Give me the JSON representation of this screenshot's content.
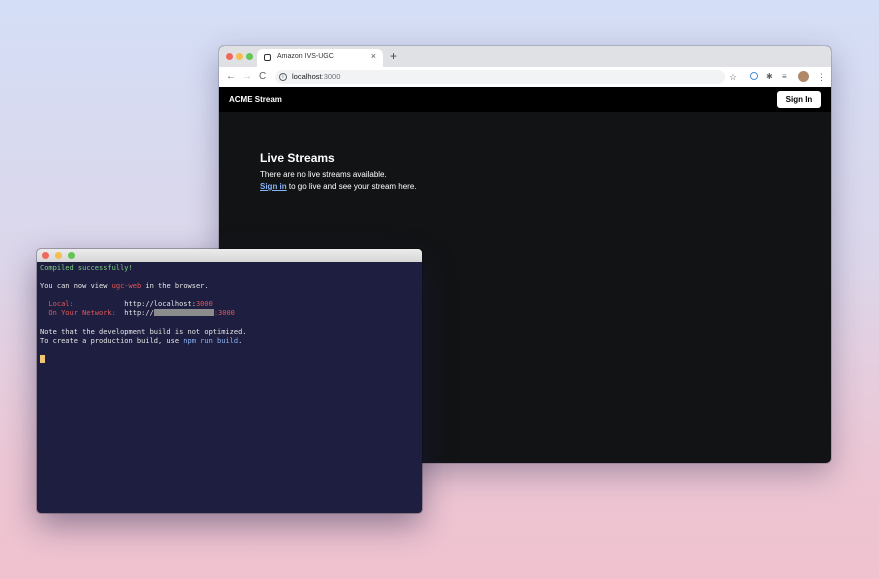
{
  "browser": {
    "tab": {
      "title": "Amazon IVS-UGC",
      "close": "×",
      "new_tab": "+"
    },
    "toolbar": {
      "back": "←",
      "forward": "→",
      "reload": "C",
      "url_host": "localhost",
      "url_port": ":3000"
    },
    "app": {
      "brand": "ACME Stream",
      "sign_in_button": "Sign In",
      "heading": "Live Streams",
      "empty_message": "There are no live streams available.",
      "cta_link": "Sign in",
      "cta_rest": " to go live and see your stream here."
    }
  },
  "terminal": {
    "compiled": "Compiled successfully!",
    "view_prefix": "You can now view ",
    "app_name": "ugc-web",
    "view_suffix": " in the browser.",
    "local_label": "  Local:            ",
    "local_url": "http://localhost:",
    "local_port": "3000",
    "network_label": "  On Your Network:  ",
    "network_url_prefix": "http://",
    "network_port": ":3000",
    "note": "Note that the development build is not optimized.",
    "build_prefix": "To create a production build, use ",
    "build_cmd": "npm run build",
    "build_suffix": "."
  },
  "colors": {
    "terminal_bg": "#1e1e40",
    "browser_page_bg": "#121315",
    "success_green": "#7fd07f",
    "accent_red": "#e05858",
    "link_blue": "#8ab4f8"
  }
}
